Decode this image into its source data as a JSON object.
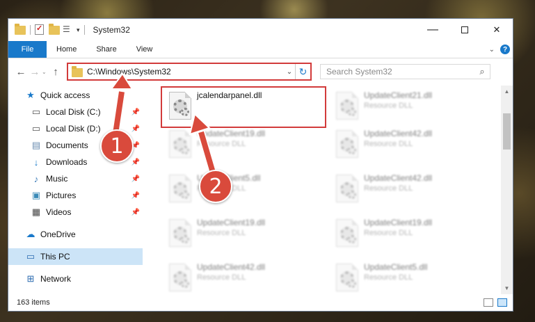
{
  "window": {
    "title": "System32",
    "controls": {
      "minimize": "—",
      "maximize": "",
      "close": "✕"
    }
  },
  "ribbon": {
    "tabs": [
      "File",
      "Home",
      "Share",
      "View"
    ],
    "help": "?"
  },
  "address": {
    "path": "C:\\Windows\\System32",
    "search_placeholder": "Search System32"
  },
  "nav": {
    "items": [
      {
        "label": "Quick access",
        "icon": "star-icon"
      },
      {
        "label": "Local Disk (C:)",
        "icon": "drive-icon",
        "pinned": true
      },
      {
        "label": "Local Disk (D:)",
        "icon": "drive-icon",
        "pinned": true
      },
      {
        "label": "Documents",
        "icon": "documents-icon",
        "pinned": true
      },
      {
        "label": "Downloads",
        "icon": "download-icon",
        "pinned": true
      },
      {
        "label": "Music",
        "icon": "music-icon",
        "pinned": true
      },
      {
        "label": "Pictures",
        "icon": "pictures-icon",
        "pinned": true
      },
      {
        "label": "Videos",
        "icon": "videos-icon",
        "pinned": true
      },
      {
        "label": "OneDrive",
        "icon": "cloud-icon"
      },
      {
        "label": "This PC",
        "icon": "monitor-icon",
        "selected": true
      },
      {
        "label": "Network",
        "icon": "network-icon"
      }
    ]
  },
  "files": {
    "highlighted": {
      "name": "jcalendarpanel.dll",
      "type": ""
    },
    "col1": [
      {
        "name": "UpdateClient19.dll",
        "type": "Resource DLL"
      },
      {
        "name": "UpdateClient5.dll",
        "type": "Resource DLL"
      },
      {
        "name": "UpdateClient19.dll",
        "type": "Resource DLL"
      },
      {
        "name": "UpdateClient42.dll",
        "type": "Resource DLL"
      }
    ],
    "col2": [
      {
        "name": "UpdateClient21.dll",
        "type": "Resource DLL"
      },
      {
        "name": "UpdateClient42.dll",
        "type": "Resource DLL"
      },
      {
        "name": "UpdateClient42.dll",
        "type": "Resource DLL"
      },
      {
        "name": "UpdateClient19.dll",
        "type": "Resource DLL"
      },
      {
        "name": "UpdateClient5.dll",
        "type": "Resource DLL"
      }
    ]
  },
  "status": {
    "count": "163 items"
  },
  "annotations": {
    "step1": "1",
    "step2": "2",
    "color": "#d94a3c"
  }
}
